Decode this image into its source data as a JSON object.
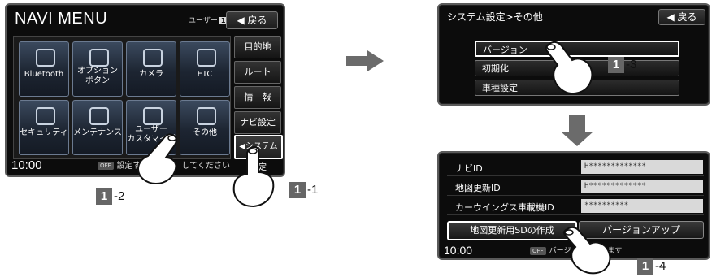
{
  "screen1": {
    "title": "NAVI MENU",
    "user_label": "ユーザー",
    "user_num": "1",
    "back_label": "◀ 戻る",
    "tiles": [
      {
        "label": "Bluetooth"
      },
      {
        "label": "オプション\nボタン"
      },
      {
        "label": "カメラ"
      },
      {
        "label": "ETC"
      },
      {
        "label": "セキュリティ"
      },
      {
        "label": "メンテナンス"
      },
      {
        "label": "ユーザー\nカスタマイズ"
      },
      {
        "label": "その他"
      }
    ],
    "side_buttons": [
      "目的地",
      "ルート",
      "情　報",
      "ナビ設定",
      "◀システム設定"
    ],
    "clock": "10:00",
    "off_badge": "OFF",
    "message": "設定する　　　　してください"
  },
  "screen2": {
    "title": "システム設定>その他",
    "back_label": "◀ 戻る",
    "items": [
      "バージョン",
      "初期化",
      "車種設定"
    ]
  },
  "screen3": {
    "rows": [
      {
        "key": "ナビID",
        "value": "H*************"
      },
      {
        "key": "地図更新ID",
        "value": "H*************"
      },
      {
        "key": "カーウイングス車載機ID",
        "value": "**********"
      }
    ],
    "button_sd": "地図更新用SDの作成",
    "button_update": "バージョンアップ",
    "clock": "10:00",
    "off_badge": "OFF",
    "message": "バージョ　　　します"
  },
  "steps": {
    "s1_num": "1",
    "s1_suffix": "-1",
    "s2_num": "1",
    "s2_suffix": "-2",
    "s3_num": "1",
    "s3_suffix": "-3",
    "s4_num": "1",
    "s4_suffix": "-4"
  },
  "colors": {
    "screen_bg": "#0c0c0c",
    "tile_top": "#3b4a5e",
    "arrow": "#6b6b6b",
    "value_field": "#d9d9d9"
  }
}
